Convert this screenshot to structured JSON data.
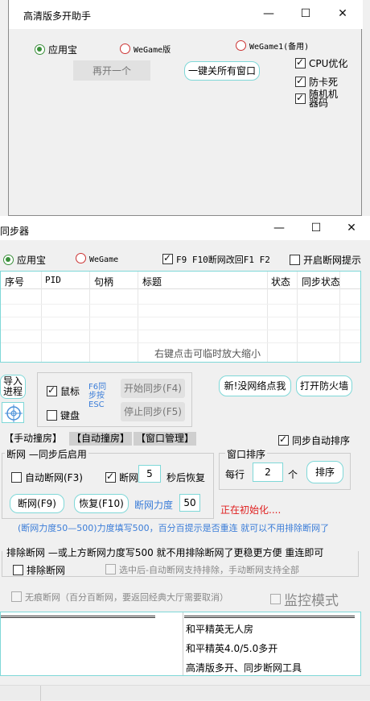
{
  "window1": {
    "title": "高清版多开助手",
    "radios": [
      {
        "label": "应用宝",
        "selected": true
      },
      {
        "label": "WeGame版",
        "selected": false
      },
      {
        "label": "WeGame1(备用)",
        "selected": false
      }
    ],
    "reopen_button": "再开一个",
    "close_all_button": "一键关所有窗口",
    "checks": [
      {
        "label": "CPU优化",
        "checked": true
      },
      {
        "label": "防卡死",
        "checked": true
      },
      {
        "label_line1": "随机机",
        "label_line2": "器码",
        "checked": true
      }
    ]
  },
  "window2": {
    "title": "同步器",
    "radios": [
      {
        "label": "应用宝",
        "selected": true
      },
      {
        "label": "WeGame",
        "selected": false
      }
    ],
    "f9_check": {
      "label": "F9 F10断网改回F1 F2",
      "checked": true
    },
    "offline_tip_check": {
      "label": "开启断网提示",
      "checked": false
    },
    "table": {
      "columns": [
        "序号",
        "PID",
        "句柄",
        "标题",
        "状态",
        "同步状态"
      ],
      "hint": "右键点击可临时放大缩小"
    },
    "import": {
      "line1": "导入",
      "line2": "进程"
    },
    "mouse_check": {
      "label": "鼠标",
      "checked": true
    },
    "keyboard_check": {
      "label": "键盘",
      "checked": false
    },
    "sync_note": {
      "l1": "F6同",
      "l2": "步按",
      "l3": "ESC"
    },
    "start_sync": "开始同步(F4)",
    "stop_sync": "停止同步(F5)",
    "new_net_button": "新!没网络点我",
    "firewall_button": "打开防火墙",
    "tabs": [
      "【手动撞房】",
      "【自动撞房】",
      "【窗口管理】"
    ],
    "auto_sort_check": {
      "label": "同步自动排序",
      "checked": true
    },
    "net_group": {
      "title": "断网  —同步后启用",
      "auto_check": {
        "label": "自动断网(F3)",
        "checked": false
      },
      "offline_check": {
        "label": "断网",
        "checked": true
      },
      "seconds_value": "5",
      "restore_label": "秒后恢复",
      "offline_btn": "断网(F9)",
      "restore_btn": "恢复(F10)",
      "strength_label": "断网力度",
      "strength_value": "50"
    },
    "window_sort": {
      "title": "窗口排序",
      "per_row_label": "每行",
      "per_row_value": "2",
      "unit": "个",
      "sort_btn": "排序"
    },
    "status_text": "正在初始化....",
    "strength_note": "(断网力度50—500)力度填写500，百分百提示是否重连 就可以不用排除断网了",
    "exclude_group": {
      "title": "排除断网 —或上方断网力度写500 就不用排除断网了更稳更方便 重连即可",
      "exclude_check": {
        "label": "排除断网",
        "checked": false
      },
      "selected_auto": {
        "label": "选中后-自动断网支持排除，手动断网支持全部",
        "checked": false
      }
    },
    "traceless": {
      "label": "无痕断网（百分百断网，要返回经典大厅需要取消）",
      "checked": false
    },
    "monitor_mode": {
      "label": "监控模式",
      "checked": false
    },
    "log_lines": [
      "和平精英无人房",
      "和平精英4.0/5.0多开",
      "高清版多开、同步断网工具"
    ]
  }
}
